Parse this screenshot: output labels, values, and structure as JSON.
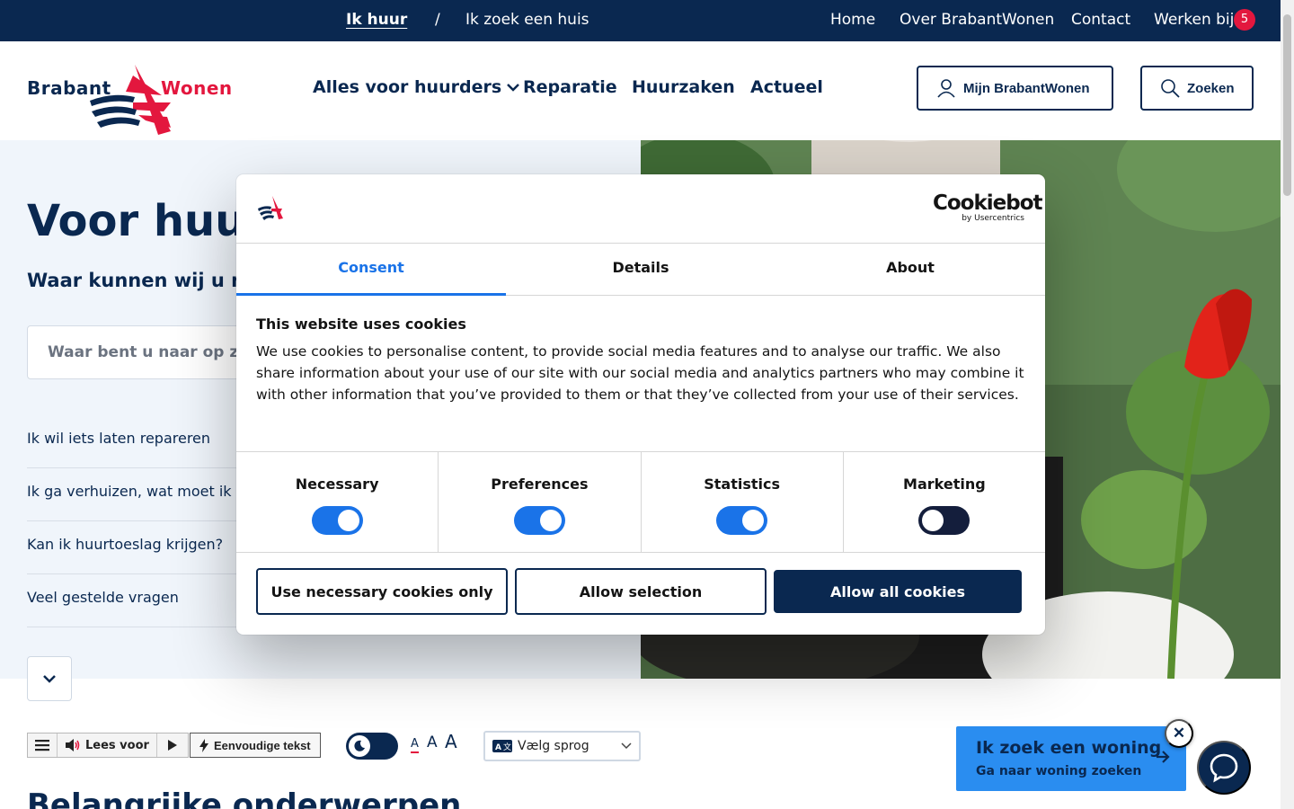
{
  "colors": {
    "navy": "#0a2850",
    "red": "#e3173e",
    "cta_blue": "#2a8df0",
    "tab_blue": "#1a73e8"
  },
  "topbar": {
    "segment_active": "Ik huur",
    "segment_separator": "/",
    "segment_other": "Ik zoek een huis",
    "links": {
      "home": "Home",
      "about": "Over BrabantWonen",
      "contact": "Contact",
      "jobs": "Werken bij"
    },
    "jobs_badge": "5"
  },
  "header": {
    "logo": {
      "brabant": "Brabant",
      "wonen": "Wonen"
    },
    "nav": {
      "tenants": "Alles voor huurders",
      "repair": "Reparatie",
      "rental": "Huurzaken",
      "news": "Actueel"
    },
    "account_button": "Mijn BrabantWonen",
    "search_button": "Zoeken",
    "icons": {
      "account": "user-icon",
      "search": "search-icon",
      "dropdown": "chevron-down-icon"
    }
  },
  "hero": {
    "title": "Voor huurders",
    "subtitle": "Waar kunnen wij u mee helpen?",
    "search_placeholder": "Waar bent u naar op zoek?",
    "links": [
      "Ik wil iets laten repareren",
      "Ik ga verhuizen, wat moet ik doen?",
      "Kan ik huurtoeslag krijgen?",
      "Veel gestelde vragen"
    ]
  },
  "toolbar": {
    "read_aloud": "Lees voor",
    "simple_text": "Eenvoudige tekst",
    "font_sizes": [
      "A",
      "A",
      "A"
    ],
    "language": "Vælg sprog"
  },
  "section": {
    "title": "Belangrijke onderwerpen"
  },
  "cta": {
    "title": "Ik zoek een woning",
    "subtitle": "Ga naar woning zoeken",
    "close": "✕"
  },
  "cookie": {
    "brand": "Cookiebot",
    "brand_sub": "by Usercentrics",
    "tabs": [
      "Consent",
      "Details",
      "About"
    ],
    "heading": "This website uses cookies",
    "body": "We use cookies to personalise content, to provide social media features and to analyse our traffic. We also share information about your use of our site with our social media and analytics partners who may combine it with other information that you’ve provided to them or that they’ve collected from your use of their services.",
    "toggles": [
      {
        "label": "Necessary",
        "on": true
      },
      {
        "label": "Preferences",
        "on": true
      },
      {
        "label": "Statistics",
        "on": true
      },
      {
        "label": "Marketing",
        "on": false
      }
    ],
    "buttons": {
      "necessary_only": "Use necessary cookies only",
      "allow_selection": "Allow selection",
      "allow_all": "Allow all cookies"
    }
  }
}
